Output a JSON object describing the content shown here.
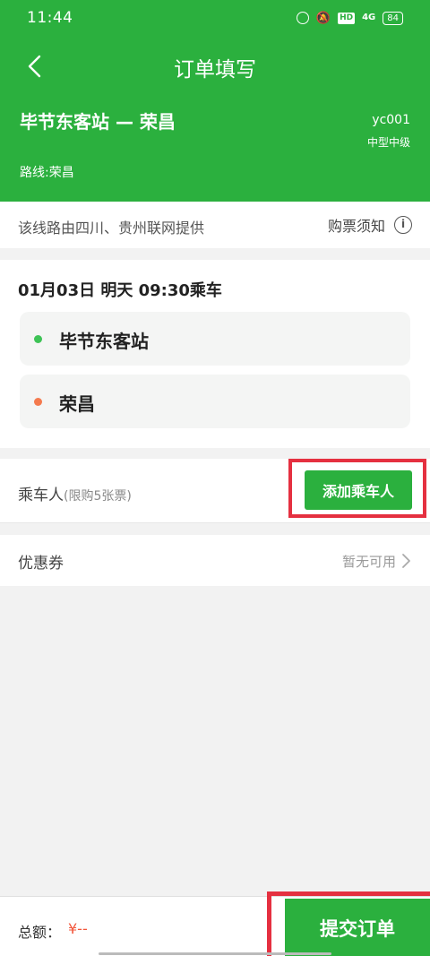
{
  "status_bar": {
    "time": "11:44",
    "signal": "4G",
    "battery": "84",
    "icons": [
      "alarm-icon",
      "mute-bell-icon",
      "hd-icon",
      "signal-icon",
      "battery-icon"
    ]
  },
  "header": {
    "title": "订单填写",
    "route": "毕节东客站 — 荣昌",
    "bus_code": "yc001",
    "bus_type": "中型中级",
    "route_line": "路线:荣昌"
  },
  "provider": {
    "text": "该线路由四川、贵州联网提供",
    "notice_label": "购票须知"
  },
  "trip": {
    "depart": "01月03日 明天 09:30乘车",
    "from_stop": "毕节东客站",
    "to_stop": "荣昌"
  },
  "passenger": {
    "label": "乘车人",
    "limit": "(限购5张票)",
    "add_button": "添加乘车人"
  },
  "coupon": {
    "label": "优惠券",
    "status": "暂无可用"
  },
  "footer": {
    "total_label": "总额：",
    "total_amount": "¥--",
    "submit_button": "提交订单"
  },
  "colors": {
    "brand_green": "#2bb03e",
    "from_dot": "#3ec356",
    "to_dot": "#f47a4e",
    "price_red": "#f2553a",
    "highlight_red": "#e53040"
  }
}
